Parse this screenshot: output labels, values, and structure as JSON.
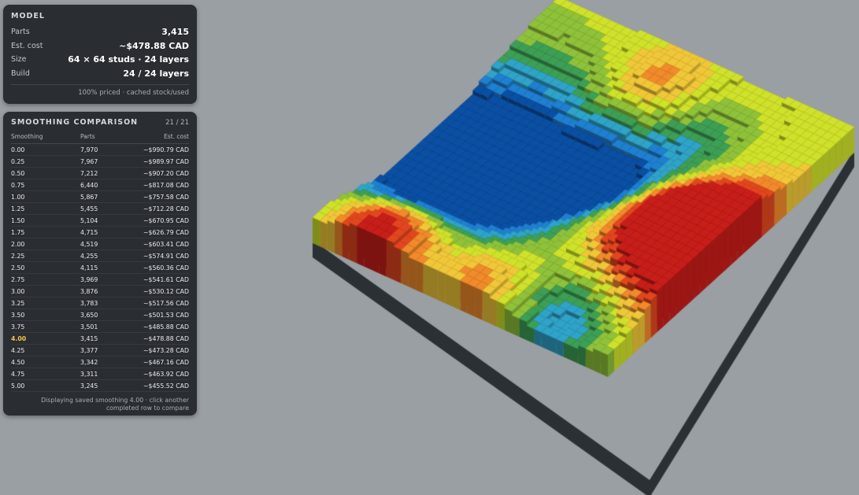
{
  "model": {
    "title": "MODEL",
    "rows": [
      {
        "label": "Parts",
        "value": "3,415"
      },
      {
        "label": "Est. cost",
        "value": "~$478.88 CAD"
      },
      {
        "label": "Size",
        "value": "64 × 64 studs · 24 layers"
      },
      {
        "label": "Build",
        "value": "24 / 24 layers"
      }
    ],
    "footnote": "100% priced · cached stock/used"
  },
  "smoothing": {
    "title": "SMOOTHING COMPARISON",
    "count": "21 / 21",
    "columns": [
      "Smoothing",
      "Parts",
      "Est. cost"
    ],
    "selected_index": 16,
    "rows": [
      {
        "smoothing": "0.00",
        "parts": "7,970",
        "cost": "~$990.79 CAD"
      },
      {
        "smoothing": "0.25",
        "parts": "7,967",
        "cost": "~$989.97 CAD"
      },
      {
        "smoothing": "0.50",
        "parts": "7,212",
        "cost": "~$907.20 CAD"
      },
      {
        "smoothing": "0.75",
        "parts": "6,440",
        "cost": "~$817.08 CAD"
      },
      {
        "smoothing": "1.00",
        "parts": "5,867",
        "cost": "~$757.58 CAD"
      },
      {
        "smoothing": "1.25",
        "parts": "5,455",
        "cost": "~$712.28 CAD"
      },
      {
        "smoothing": "1.50",
        "parts": "5,104",
        "cost": "~$670.95 CAD"
      },
      {
        "smoothing": "1.75",
        "parts": "4,715",
        "cost": "~$626.79 CAD"
      },
      {
        "smoothing": "2.00",
        "parts": "4,519",
        "cost": "~$603.41 CAD"
      },
      {
        "smoothing": "2.25",
        "parts": "4,255",
        "cost": "~$574.91 CAD"
      },
      {
        "smoothing": "2.50",
        "parts": "4,115",
        "cost": "~$560.36 CAD"
      },
      {
        "smoothing": "2.75",
        "parts": "3,969",
        "cost": "~$541.61 CAD"
      },
      {
        "smoothing": "3.00",
        "parts": "3,876",
        "cost": "~$530.12 CAD"
      },
      {
        "smoothing": "3.25",
        "parts": "3,783",
        "cost": "~$517.56 CAD"
      },
      {
        "smoothing": "3.50",
        "parts": "3,650",
        "cost": "~$501.53 CAD"
      },
      {
        "smoothing": "3.75",
        "parts": "3,501",
        "cost": "~$485.88 CAD"
      },
      {
        "smoothing": "4.00",
        "parts": "3,415",
        "cost": "~$478.88 CAD"
      },
      {
        "smoothing": "4.25",
        "parts": "3,377",
        "cost": "~$473.28 CAD"
      },
      {
        "smoothing": "4.50",
        "parts": "3,342",
        "cost": "~$467.16 CAD"
      },
      {
        "smoothing": "4.75",
        "parts": "3,311",
        "cost": "~$463.92 CAD"
      },
      {
        "smoothing": "5.00",
        "parts": "3,245",
        "cost": "~$455.52 CAD"
      }
    ],
    "footer": "Displaying saved smoothing 4.00 · click another completed row to compare"
  },
  "viewport": {
    "background": "#9a9fa3",
    "palette": [
      "#0b4fa3",
      "#1f7fd0",
      "#2fa3c8",
      "#3d9f55",
      "#8fc23a",
      "#cfe12a",
      "#f0c738",
      "#f08a2b",
      "#e2461f",
      "#c81e1a"
    ]
  }
}
